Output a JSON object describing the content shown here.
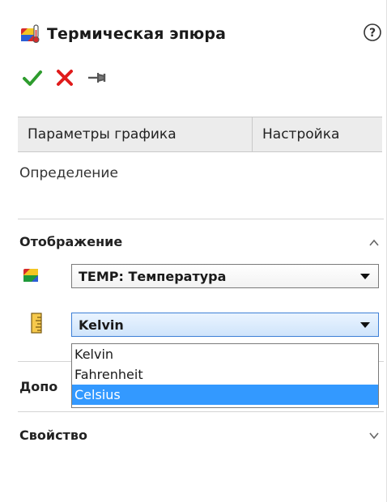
{
  "header": {
    "title": "Термическая эпюра",
    "title_icon": "thermal-plot-icon",
    "help_icon": "help-icon"
  },
  "actions": [
    {
      "name": "ok-button",
      "icon": "checkmark-icon",
      "color": "#2e9c2e"
    },
    {
      "name": "cancel-button",
      "icon": "close-icon",
      "color": "#e01b1b"
    },
    {
      "name": "pin-button",
      "icon": "pin-icon",
      "color": "#555555"
    }
  ],
  "tabs": [
    {
      "label": "Параметры графика"
    },
    {
      "label": "Настройка"
    }
  ],
  "definition": {
    "label": "Определение"
  },
  "display": {
    "title": "Отображение",
    "component_select": {
      "value": "TEMP: Температура",
      "icon": "temperature-component-icon"
    },
    "units_select": {
      "value": "Kelvin",
      "icon": "units-ruler-icon"
    },
    "units_options": [
      "Kelvin",
      "Fahrenheit",
      "Celsius"
    ],
    "highlighted_option": "Celsius"
  },
  "additional": {
    "title_partial": "Допо"
  },
  "property": {
    "title": "Свойство"
  },
  "colors": {
    "accent": "#3399ff",
    "ok": "#2e9c2e",
    "cancel": "#e01b1b"
  }
}
